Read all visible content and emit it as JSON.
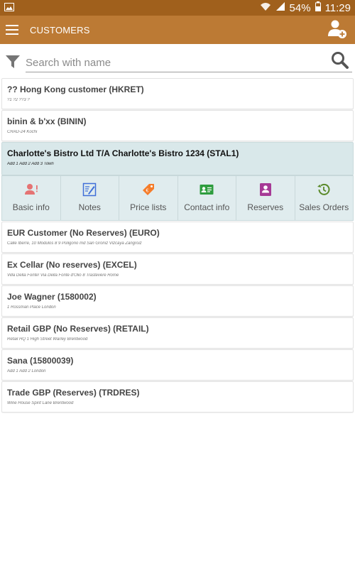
{
  "status": {
    "battery": "54%",
    "time": "11:29"
  },
  "appbar": {
    "title": "CUSTOMERS"
  },
  "search": {
    "placeholder": "Search with name"
  },
  "customers": [
    {
      "name": "?? Hong Kong customer (HKRET)",
      "address": "?1 ?2 ??3 ?"
    },
    {
      "name": "binin & b'xx (BININ)",
      "address": "CRAD-24   Kochi"
    },
    {
      "name": "Charlotte's Bistro Ltd T/A Charlotte's Bistro 1234 (STAL1)",
      "address": "Add 1 Add 2 Add 3 Town"
    },
    {
      "name": "EUR Customer (No Reserves) (EURO)",
      "address": "Calle Iberre, 10 Modulos 8 9  Poligono Ind San Groniz Vizcaya Zangroiz"
    },
    {
      "name": "Ex Cellar  (No reserves) (EXCEL)",
      "address": "Villa Della Fonte! Via Della Fonte d'Olio 8 Trastevere Rome"
    },
    {
      "name": "Joe Wagner (1580002)",
      "address": "1 Rossman Place   London"
    },
    {
      "name": "Retail GBP (No Reserves) (RETAIL)",
      "address": "Retail HQ 1 High Street Warley Brentwood"
    },
    {
      "name": "Sana (15800039)",
      "address": "Add 1 Add 2  London"
    },
    {
      "name": "Trade GBP (Reserves) (TRDRES)",
      "address": "Wine House Spirit Lane  Brentwood"
    }
  ],
  "actions": [
    {
      "label": "Basic info",
      "icon": "person-alert-icon",
      "color": "#e57373"
    },
    {
      "label": "Notes",
      "icon": "notes-icon",
      "color": "#3f6fd8"
    },
    {
      "label": "Price lists",
      "icon": "price-tag-icon",
      "color": "#f57c2a"
    },
    {
      "label": "Contact info",
      "icon": "contact-card-icon",
      "color": "#2e9d3e"
    },
    {
      "label": "Reserves",
      "icon": "reserves-icon",
      "color": "#a63a96"
    },
    {
      "label": "Sales Orders",
      "icon": "history-icon",
      "color": "#5a8a2a"
    }
  ]
}
